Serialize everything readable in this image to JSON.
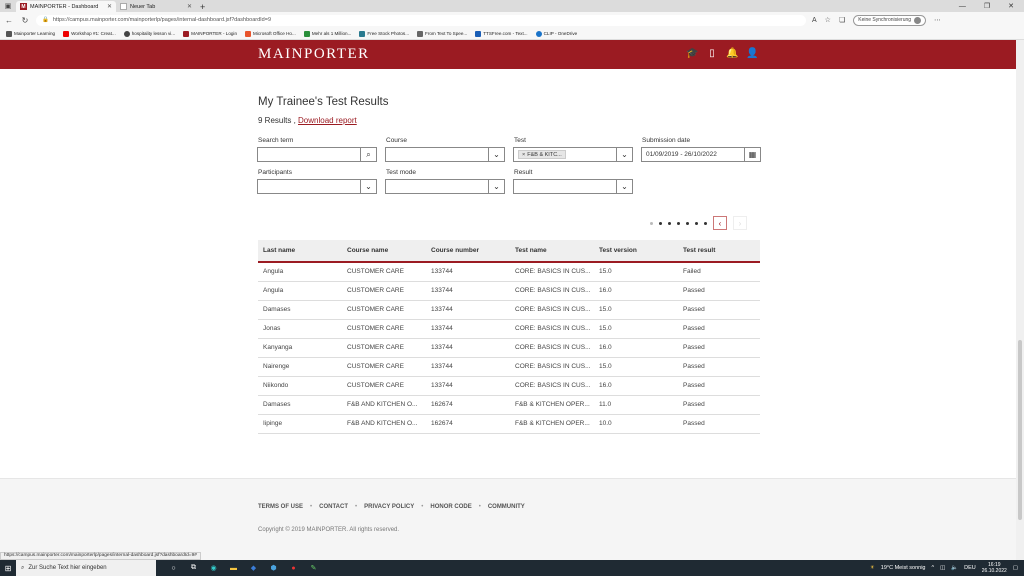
{
  "browser": {
    "tabs": [
      {
        "label": "MAINPORTER - Dashboard",
        "active": true
      },
      {
        "label": "Neuer Tab",
        "active": false
      }
    ],
    "url": "https://campus.mainporter.com/mainporterlp/pages/internal-dashboard.jsf?dashboardId=9",
    "sync_label": "Keine Synchronisierung",
    "favorites": [
      "Mainporter Learning",
      "Workshop #1: Creat...",
      "hospitality lesson vi...",
      "MAINPORTER - Login",
      "Microsoft Office Ho...",
      "Mehr als 1 Million...",
      "Free Stock Photos...",
      "From Text To Spee...",
      "TTSFree.com - Text...",
      "CLIP - OneDrive"
    ]
  },
  "header": {
    "logo": "MAINPORTER"
  },
  "main": {
    "title": "My Trainee's Test Results",
    "results_count": "9 Results ,",
    "download_label": "Download report",
    "filters": {
      "search_label": "Search term",
      "course_label": "Course",
      "test_label": "Test",
      "test_chip": "F&B & KITC...",
      "submission_label": "Submission date",
      "submission_value": "01/09/2019 - 26/10/2022",
      "participants_label": "Participants",
      "testmode_label": "Test mode",
      "result_label": "Result"
    },
    "columns": [
      "Last name",
      "Course name",
      "Course number",
      "Test name",
      "Test version",
      "Test result"
    ],
    "rows": [
      [
        "Angula",
        "CUSTOMER CARE",
        "133744",
        "CORE: BASICS IN CUS...",
        "15.0",
        "Failed"
      ],
      [
        "Angula",
        "CUSTOMER CARE",
        "133744",
        "CORE: BASICS IN CUS...",
        "16.0",
        "Passed"
      ],
      [
        "Damases",
        "CUSTOMER CARE",
        "133744",
        "CORE: BASICS IN CUS...",
        "15.0",
        "Passed"
      ],
      [
        "Jonas",
        "CUSTOMER CARE",
        "133744",
        "CORE: BASICS IN CUS...",
        "15.0",
        "Passed"
      ],
      [
        "Kanyanga",
        "CUSTOMER CARE",
        "133744",
        "CORE: BASICS IN CUS...",
        "16.0",
        "Passed"
      ],
      [
        "Nairenge",
        "CUSTOMER CARE",
        "133744",
        "CORE: BASICS IN CUS...",
        "15.0",
        "Passed"
      ],
      [
        "Niikondo",
        "CUSTOMER CARE",
        "133744",
        "CORE: BASICS IN CUS...",
        "16.0",
        "Passed"
      ],
      [
        "Damases",
        "F&B AND KITCHEN O...",
        "162674",
        "F&B & KITCHEN OPER...",
        "11.0",
        "Passed"
      ],
      [
        "Iipinge",
        "F&B AND KITCHEN O...",
        "162674",
        "F&B & KITCHEN OPER...",
        "10.0",
        "Passed"
      ]
    ]
  },
  "footer": {
    "links": [
      "TERMS OF USE",
      "CONTACT",
      "PRIVACY POLICY",
      "HONOR CODE",
      "COMMUNITY"
    ],
    "copyright": "Copyright © 2019 MAINPORTER. All rights reserved."
  },
  "status_url": "https://campus.mainporter.com/mainporterlp/pages/internal-dashboard.jsf?dashboardId=9#",
  "taskbar": {
    "search_placeholder": "Zur Suche Text hier eingeben",
    "weather": "19°C  Meist sonnig",
    "lang": "DEU",
    "time": "16:19",
    "date": "26.10.2022"
  },
  "colors": {
    "brand": "#9b1b22",
    "taskbar": "#1f2a33"
  }
}
